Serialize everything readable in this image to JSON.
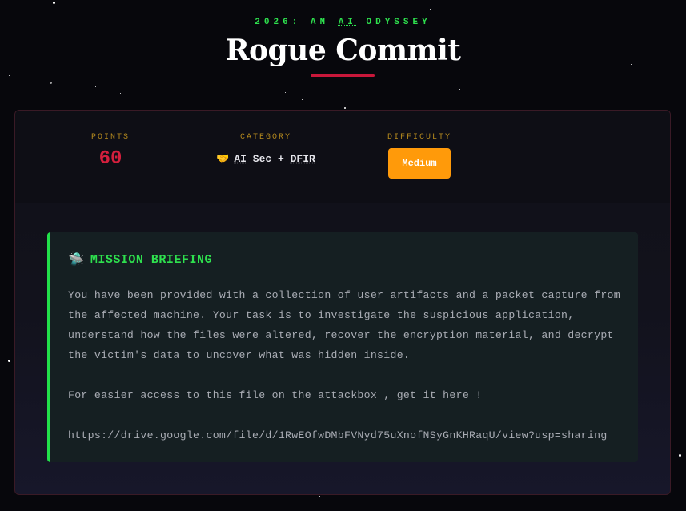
{
  "header": {
    "eyebrow_prefix": "2026: AN",
    "eyebrow_ai": "AI",
    "eyebrow_suffix": "ODYSSEY",
    "title": "Rogue Commit"
  },
  "meta": {
    "points_label": "POINTS",
    "points_value": "60",
    "category_label": "CATEGORY",
    "category_icon": "handshake-icon",
    "category_ai": "AI",
    "category_mid": "Sec +",
    "category_dfir": "DFIR",
    "difficulty_label": "DIFFICULTY",
    "difficulty_value": "Medium"
  },
  "briefing": {
    "icon": "ufo-icon",
    "title": "MISSION BRIEFING",
    "paragraph1": "You have been provided with a collection of user artifacts and a packet capture from the affected machine. Your task is to investigate the suspicious application, understand how the files were altered, recover the encryption material, and decrypt the victim's data to uncover what was hidden inside.",
    "paragraph2": "For easier access to this file on the attackbox , get it here !",
    "link": "https://drive.google.com/file/d/1RwEOfwDMbFVNyd75uXnofNSyGnKHRaqU/view?usp=sharing"
  },
  "colors": {
    "accent_green": "#2ee04e",
    "accent_red": "#d41f3d",
    "label_gold": "#b58a1e",
    "difficulty_orange": "#ff9a0a"
  }
}
